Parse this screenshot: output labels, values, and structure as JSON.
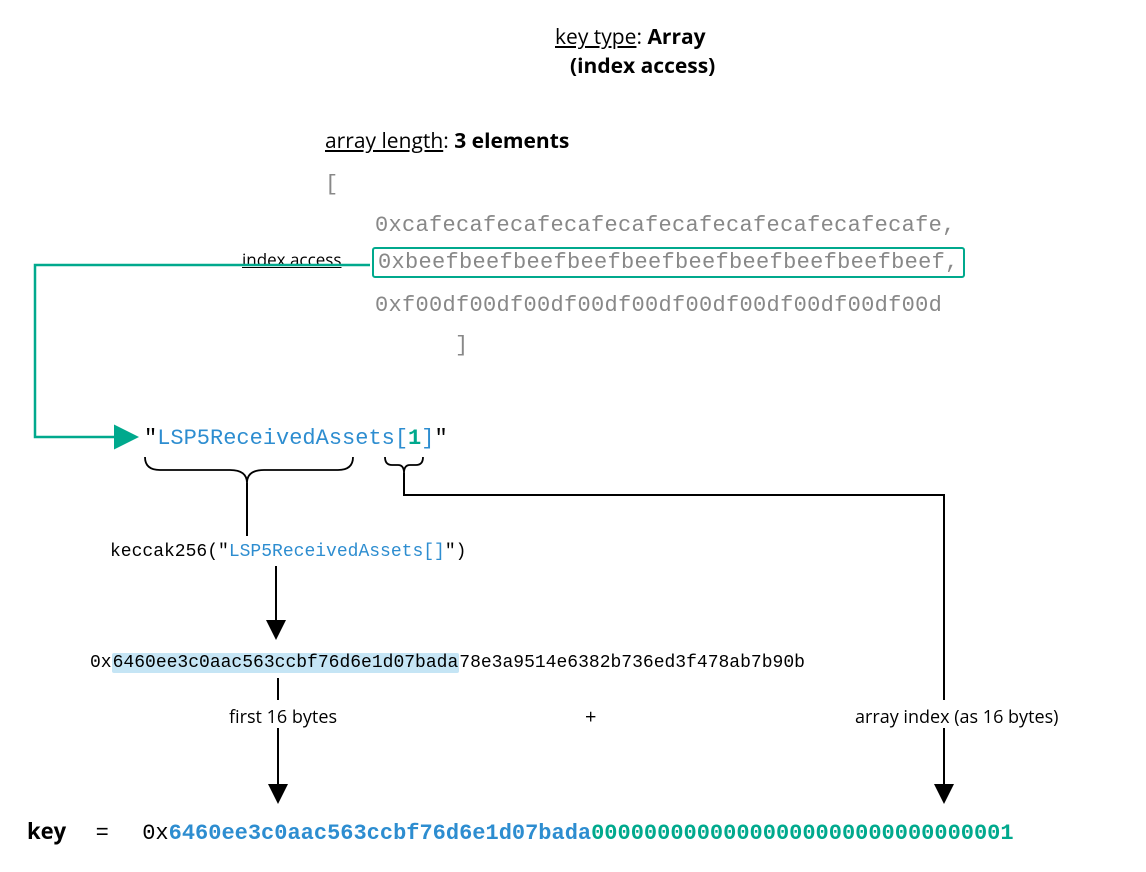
{
  "header": {
    "keyTypeLabel": "key type",
    "keyTypeValue": "Array",
    "indexAccessNote": "(index access)"
  },
  "arraySection": {
    "arrayLengthLabel": "array length",
    "arrayLengthValue": "3 elements",
    "openBracket": "[",
    "closeBracket": "]",
    "items": [
      "0xcafecafecafecafecafecafecafecafecafecafe,",
      "0xbeefbeefbeefbeefbeefbeefbeefbeefbeefbeef,",
      "0xf00df00df00df00df00df00df00df00df00df00d"
    ],
    "indexAccessLabel": "index access"
  },
  "keyExpression": {
    "quoteOpen": "\"",
    "namePart": "LSP5ReceivedAssets[",
    "indexPart": "1",
    "closePart": "]",
    "quoteClose": "\""
  },
  "hashLine": {
    "prefix": "keccak256(\"",
    "name": "LSP5ReceivedAssets[]",
    "suffix": "\")"
  },
  "hashResult": {
    "prefix": "0x",
    "hlPart": "6460ee3c0aac563ccbf76d6e1d07bada",
    "rest": "78e3a9514e6382b736ed3f478ab7b90b"
  },
  "labels": {
    "first16": "first 16 bytes",
    "plus": "+",
    "arrayIndex16": "array index (as 16 bytes)"
  },
  "finalKey": {
    "label": "key",
    "equals": "=",
    "prefix": "0x",
    "bluePart": "6460ee3c0aac563ccbf76d6e1d07bada",
    "greenPart": "00000000000000000000000000000001"
  }
}
